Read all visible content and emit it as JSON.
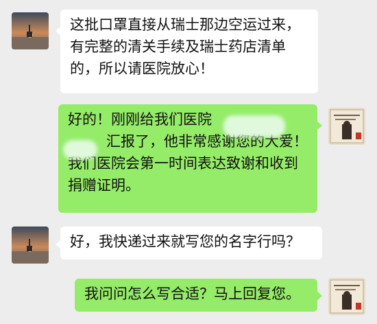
{
  "messages": [
    {
      "sender": "contact",
      "lines": [
        "这批口罩直接从瑞士那边空运过来，",
        "有完整的清关手续及瑞士药店清单",
        "的，所以请医院放心！"
      ]
    },
    {
      "sender": "me",
      "lines": [
        "好的！刚刚给我们医院",
        "汇报了，他非常感谢您的大爱！",
        "我们医院会第一时间表达致谢和收到",
        "捐赠证明。"
      ]
    },
    {
      "sender": "contact",
      "lines": [
        "好，我快递过来就写您的名字行吗？"
      ]
    },
    {
      "sender": "me",
      "lines": [
        "我问问怎么写合适？马上回复您。"
      ]
    }
  ],
  "colors": {
    "background": "#ededed",
    "incoming_bubble": "#ffffff",
    "outgoing_bubble": "#95ec69"
  },
  "icons": {
    "contact_avatar": "sunset-lake-avatar",
    "my_avatar": "calligraphy-avatar"
  }
}
